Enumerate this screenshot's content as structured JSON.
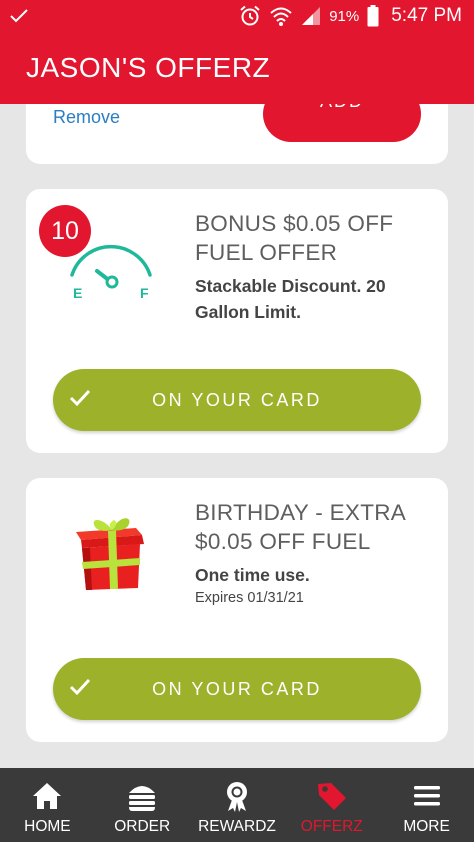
{
  "status_bar": {
    "battery_percent": "91%",
    "time": "5:47 PM",
    "icons": [
      "check-icon",
      "alarm-icon",
      "wifi-icon",
      "signal-icon",
      "battery-icon"
    ]
  },
  "header": {
    "title": "JASON'S OFFERZ"
  },
  "partial_card": {
    "remove_label": "Remove",
    "add_label": "ADD"
  },
  "offers": [
    {
      "points": "10",
      "icon": "fuel-gauge-icon",
      "title": "BONUS $0.05 OFF FUEL OFFER",
      "description": "Stackable Discount. 20 Gallon Limit.",
      "gauge_e": "E",
      "gauge_f": "F",
      "button_label": "ON YOUR CARD"
    },
    {
      "icon": "gift-box-icon",
      "title": "BIRTHDAY - EXTRA $0.05 OFF FUEL",
      "description": "One time use.",
      "expiry": "Expires 01/31/21",
      "button_label": "ON YOUR CARD"
    }
  ],
  "nav": [
    {
      "label": "HOME",
      "icon": "home-icon"
    },
    {
      "label": "ORDER",
      "icon": "burger-icon"
    },
    {
      "label": "REWARDZ",
      "icon": "award-icon"
    },
    {
      "label": "OFFERZ",
      "icon": "tag-icon",
      "active": true
    },
    {
      "label": "MORE",
      "icon": "menu-icon"
    }
  ],
  "colors": {
    "brand_red": "#e2162e",
    "button_green": "#9db22a",
    "gauge_teal": "#1fb89a",
    "nav_background": "#3a3a3a",
    "link_blue": "#2a7ec4"
  }
}
